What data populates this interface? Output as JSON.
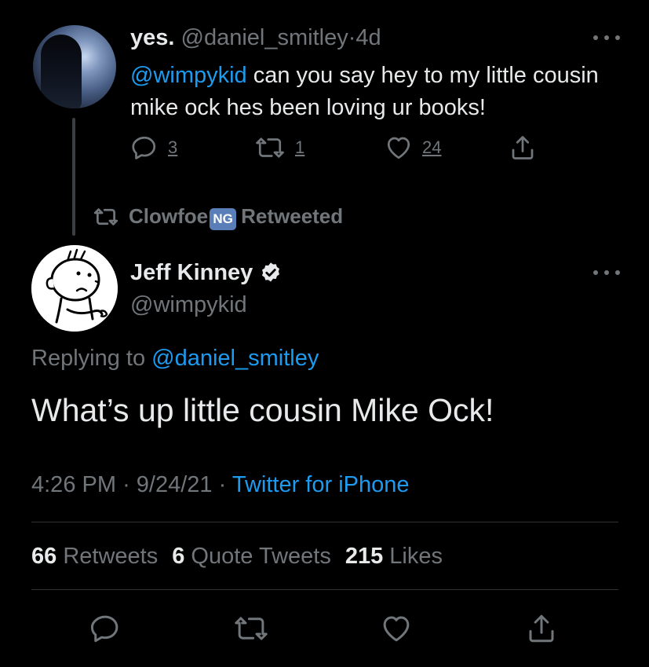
{
  "parent_tweet": {
    "display_name": "yes.",
    "handle": "@daniel_smitley",
    "separator": "·",
    "time_ago": "4d",
    "mention": "@wimpykid",
    "text_rest": " can you say hey to my little cousin mike ock hes been loving ur books!",
    "replies": "3",
    "retweets": "1",
    "likes": "24"
  },
  "retweet_context": {
    "user": "Clowfoe",
    "badge": "NG",
    "label": "Retweeted"
  },
  "main_tweet": {
    "display_name": "Jeff Kinney",
    "handle": "@wimpykid",
    "replying_label": "Replying to",
    "replying_handle": "@daniel_smitley",
    "text": "What’s up little cousin Mike Ock!",
    "time": "4:26 PM",
    "date": "9/24/21",
    "source": "Twitter for iPhone",
    "dot": "·"
  },
  "stats": {
    "retweets_count": "66",
    "retweets_label": "Retweets",
    "quotes_count": "6",
    "quotes_label": "Quote Tweets",
    "likes_count": "215",
    "likes_label": "Likes"
  },
  "icons": {
    "reply": "reply-icon",
    "retweet": "retweet-icon",
    "like": "heart-icon",
    "share": "share-icon",
    "verified": "verified-badge-icon",
    "more": "more-options-icon"
  },
  "colors": {
    "background": "#000000",
    "primary_text": "#e7e9ea",
    "secondary_text": "#71767b",
    "link": "#1d9bf0",
    "divider": "#2f3336",
    "badge_bg": "#5a7fb8"
  }
}
